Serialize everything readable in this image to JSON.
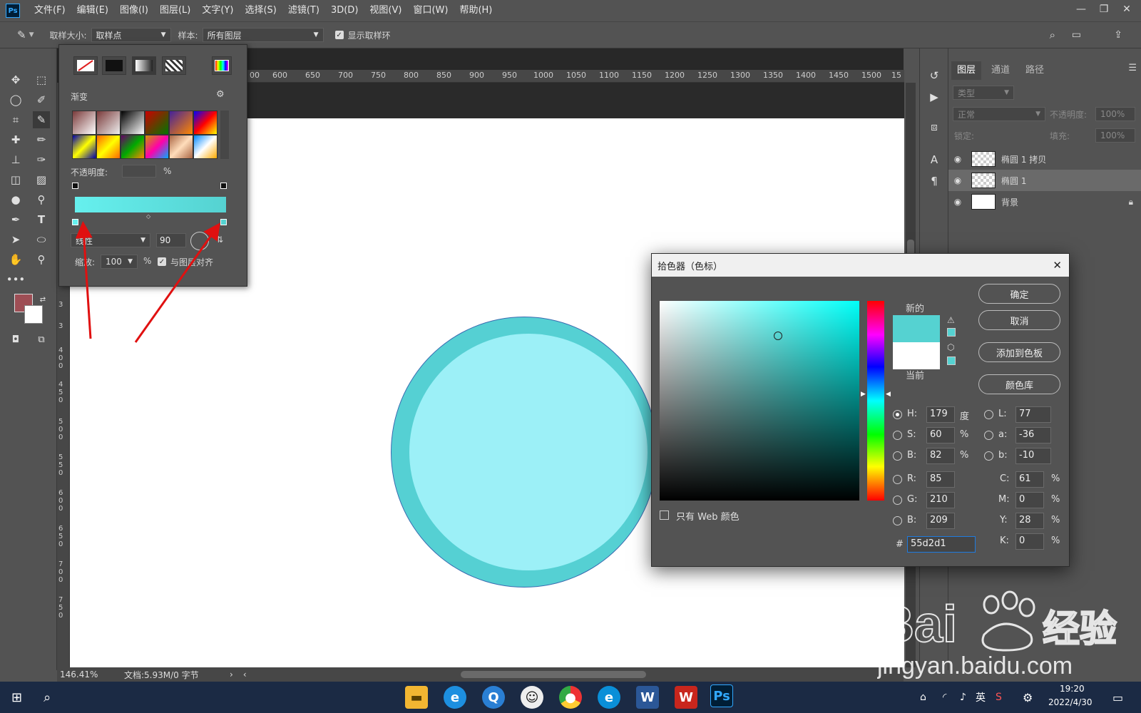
{
  "menu": [
    "文件(F)",
    "编辑(E)",
    "图像(I)",
    "图层(L)",
    "文字(Y)",
    "选择(S)",
    "滤镜(T)",
    "3D(D)",
    "视图(V)",
    "窗口(W)",
    "帮助(H)"
  ],
  "app_logo": "Ps",
  "options": {
    "sample_size_label": "取样大小:",
    "sample_size_value": "取样点",
    "sample_label": "样本:",
    "sample_value": "所有图层",
    "show_ring_label": "显示取样环"
  },
  "ruler_top": [
    "00",
    "600",
    "650",
    "700",
    "750",
    "800",
    "850",
    "900",
    "950",
    "1000",
    "1050",
    "1100",
    "1150",
    "1200",
    "1250",
    "1300",
    "1350",
    "1400",
    "1450",
    "1500",
    "15"
  ],
  "ruler_left": [
    "3",
    "3",
    "4",
    "0",
    "0",
    "4",
    "5",
    "0",
    "5",
    "0",
    "0",
    "5",
    "5",
    "0",
    "6",
    "0",
    "0",
    "6",
    "5",
    "0",
    "7",
    "0",
    "0",
    "7",
    "5",
    "0"
  ],
  "gradient_panel": {
    "title": "渐变",
    "opacity_label": "不透明度:",
    "opacity_unit": "%",
    "style_value": "线性",
    "angle_value": "90",
    "scale_label": "缩放:",
    "scale_value": "100",
    "scale_unit": "%",
    "align_label": "与图层对齐",
    "bar_from": "#66f0ee",
    "bar_to": "#55d2d1"
  },
  "status": {
    "zoom": "146.41%",
    "doc": "文档:5.93M/0 字节"
  },
  "layers_panel": {
    "tabs": [
      "图层",
      "通道",
      "路径"
    ],
    "filter_placeholder": "类型",
    "blend_mode": "正常",
    "opacity_label": "不透明度:",
    "opacity_value": "100%",
    "lock_label": "锁定:",
    "fill_label": "填充:",
    "fill_value": "100%",
    "layers": [
      {
        "name": "椭圆 1 拷贝"
      },
      {
        "name": "椭圆 1"
      },
      {
        "name": "背景"
      }
    ]
  },
  "picker": {
    "title": "拾色器（色标）",
    "new_label": "新的",
    "current_label": "当前",
    "new_color": "#55d2d1",
    "current_color": "#ffffff",
    "buttons": [
      "确定",
      "取消",
      "添加到色板",
      "颜色库"
    ],
    "web_only_label": "只有 Web 颜色",
    "hsb": [
      {
        "label": "H:",
        "value": "179",
        "unit": "度"
      },
      {
        "label": "S:",
        "value": "60",
        "unit": "%"
      },
      {
        "label": "B:",
        "value": "82",
        "unit": "%"
      }
    ],
    "rgb": [
      {
        "label": "R:",
        "value": "85"
      },
      {
        "label": "G:",
        "value": "210"
      },
      {
        "label": "B:",
        "value": "209"
      }
    ],
    "lab": [
      {
        "label": "L:",
        "value": "77"
      },
      {
        "label": "a:",
        "value": "-36"
      },
      {
        "label": "b:",
        "value": "-10"
      }
    ],
    "cmyk": [
      {
        "label": "C:",
        "value": "61",
        "unit": "%"
      },
      {
        "label": "M:",
        "value": "0",
        "unit": "%"
      },
      {
        "label": "Y:",
        "value": "28",
        "unit": "%"
      },
      {
        "label": "K:",
        "value": "0",
        "unit": "%"
      }
    ],
    "hex_label": "#",
    "hex_value": "55d2d1"
  },
  "taskbar": {
    "lang": "英",
    "time": "19:20",
    "date": "2022/4/30"
  },
  "watermark": {
    "brand": "Bai",
    "brand2": "经验",
    "url": "jingyan.baidu.com"
  }
}
